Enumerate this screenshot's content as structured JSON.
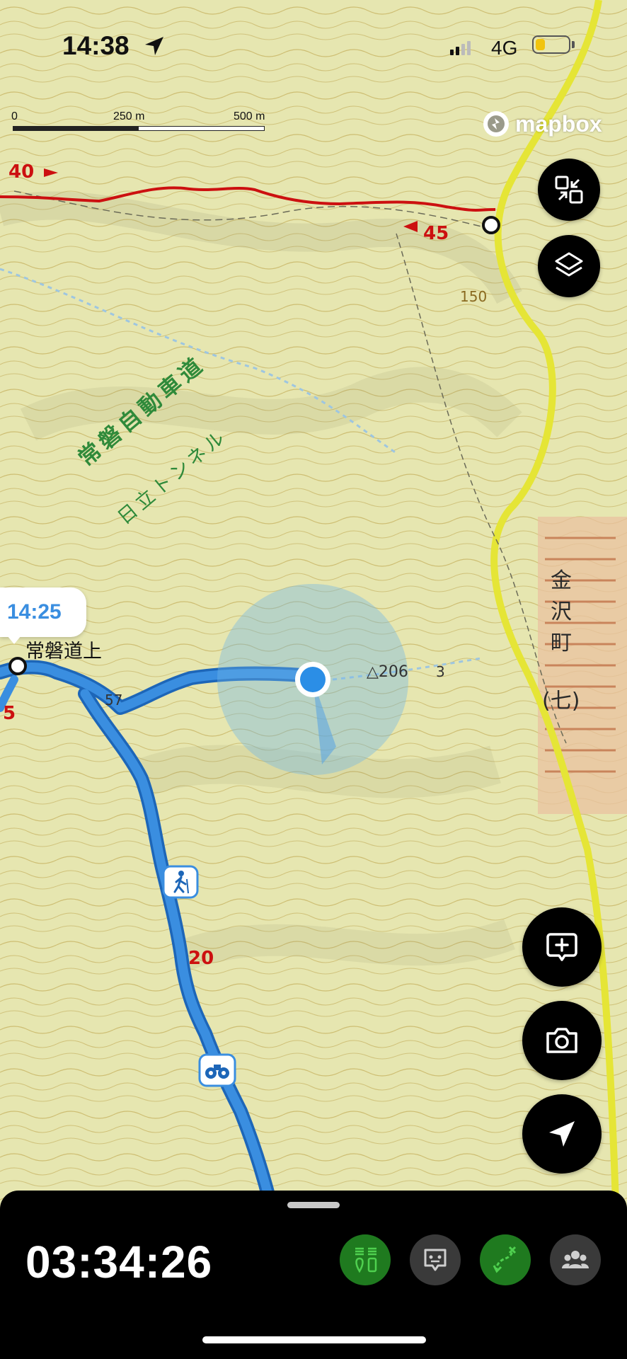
{
  "status_bar": {
    "time": "14:38",
    "network": "4G",
    "battery_level": 0.3,
    "location_icon": "location-arrow-icon"
  },
  "scale_bar": {
    "labels": [
      "0",
      "250 m",
      "500 m"
    ]
  },
  "attribution": {
    "text": "mapbox",
    "icon": "mapbox-logo-icon"
  },
  "map": {
    "labels": {
      "expressway": "常磐自動車道",
      "tunnel": "日立トンネル",
      "town": "金沢町",
      "town_suffix": "七",
      "spot_height": "△206",
      "contour_150": "150",
      "contour_57": "57",
      "marker_3": "3"
    },
    "route_markers": [
      "40",
      "45",
      "5",
      "20"
    ],
    "time_bubble": "14:25",
    "place_name": "常磐道上",
    "poi_icons": [
      "hiker-icon",
      "binoculars-icon"
    ]
  },
  "map_controls": [
    "collapse-icon",
    "layers-icon"
  ],
  "action_buttons": [
    "add-note-icon",
    "camera-icon",
    "navigation-arrow-icon"
  ],
  "bottom_sheet": {
    "elapsed_time": "03:34:26",
    "tools": [
      {
        "name": "elevation-pins-icon",
        "active": true
      },
      {
        "name": "chat-bot-icon",
        "active": false
      },
      {
        "name": "route-edit-icon",
        "active": true
      },
      {
        "name": "group-icon",
        "active": false
      }
    ]
  },
  "colors": {
    "route_blue": "#3a8ee0",
    "route_red": "#cc1010",
    "road_yellow": "#e5e536",
    "map_bg": "#e6e6b0",
    "active_tool": "#1f7a1f"
  }
}
